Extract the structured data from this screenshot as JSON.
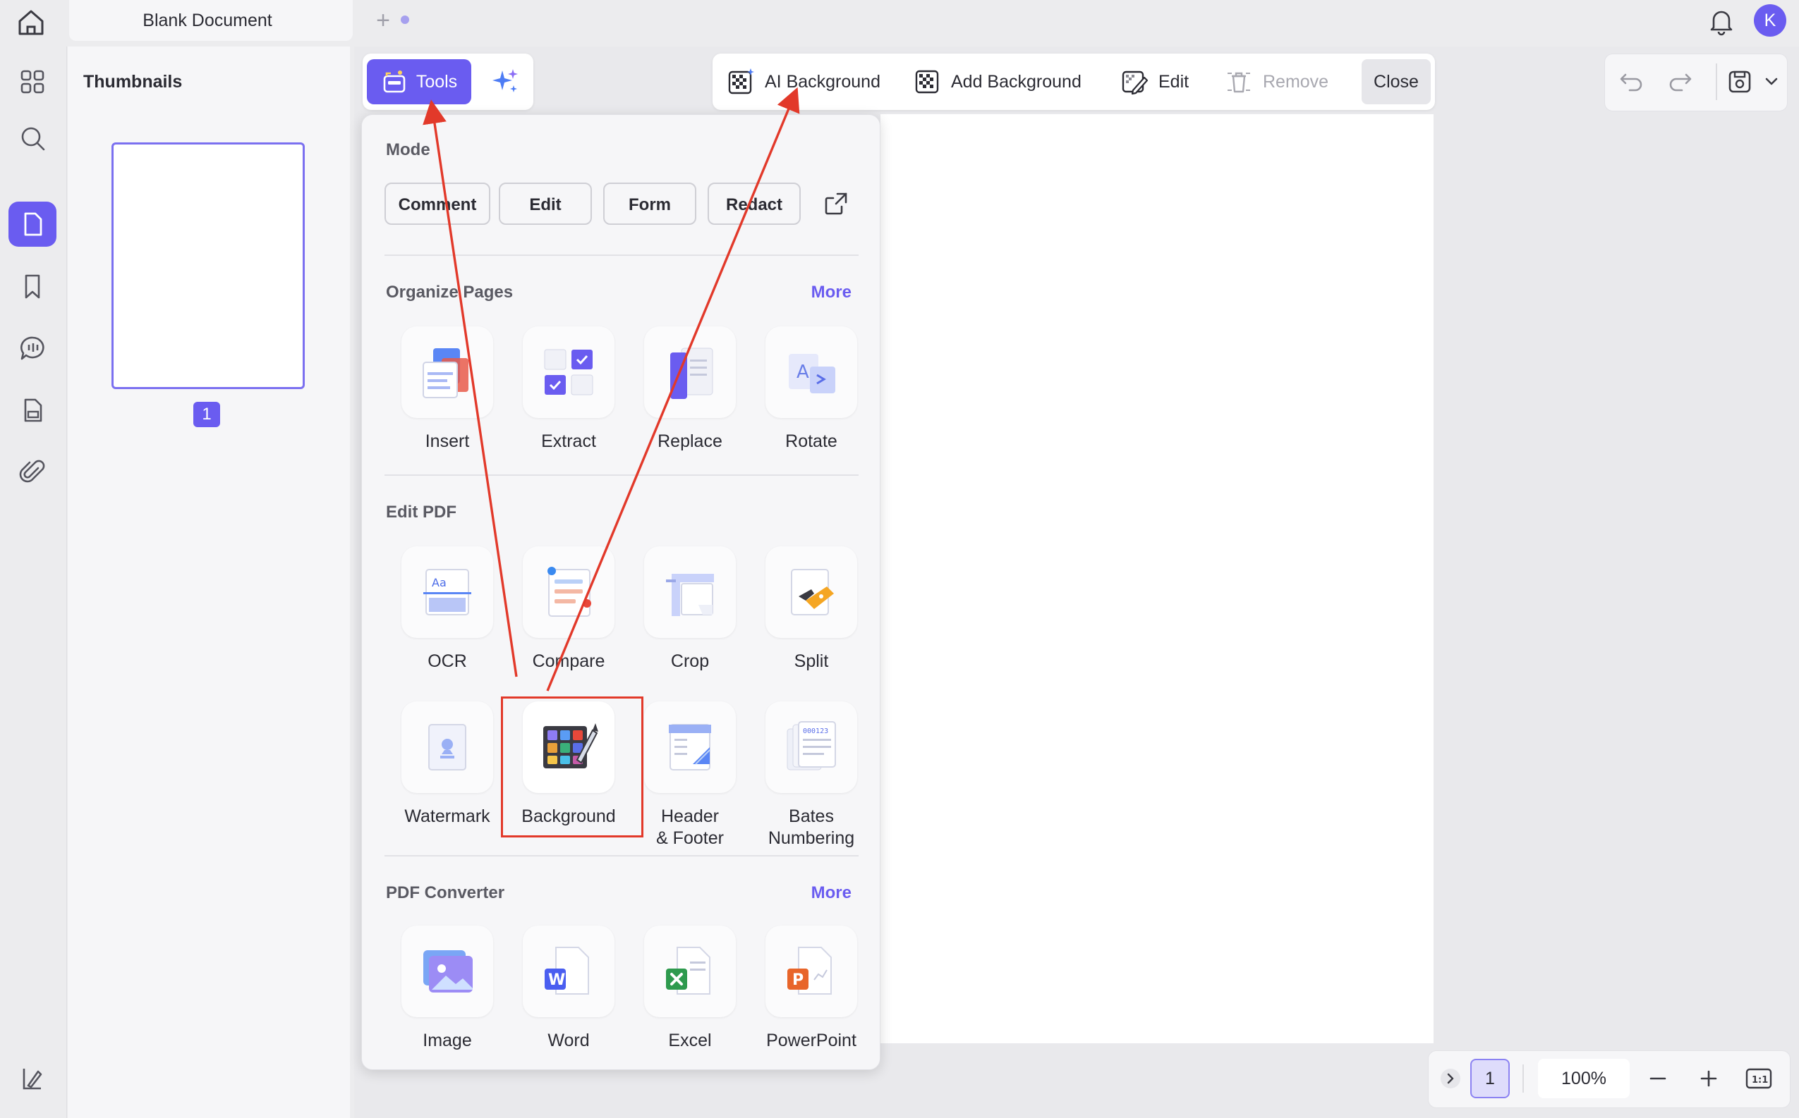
{
  "tab": {
    "title": "Blank Document"
  },
  "topbar": {
    "avatar_initial": "K"
  },
  "thumbnails": {
    "title": "Thumbnails",
    "page_number": "1"
  },
  "toolbar": {
    "tools_label": "Tools"
  },
  "background_bar": {
    "ai_background": "AI Background",
    "add_background": "Add Background",
    "edit": "Edit",
    "remove": "Remove",
    "close": "Close"
  },
  "popup": {
    "mode_title": "Mode",
    "mode_buttons": [
      "Comment",
      "Edit",
      "Form",
      "Redact"
    ],
    "organize_title": "Organize Pages",
    "organize_more": "More",
    "organize_tools": [
      "Insert",
      "Extract",
      "Replace",
      "Rotate"
    ],
    "edit_title": "Edit PDF",
    "edit_tools": [
      "OCR",
      "Compare",
      "Crop",
      "Split",
      "Watermark",
      "Background",
      "Header\n& Footer",
      "Bates\nNumbering"
    ],
    "converter_title": "PDF Converter",
    "converter_more": "More",
    "converter_tools": [
      "Image",
      "Word",
      "Excel",
      "PowerPoint"
    ]
  },
  "zoom": {
    "page": "1",
    "value": "100%"
  },
  "colors": {
    "accent": "#6a5cf0",
    "annotation": "#e2392a",
    "page": "#ffffff"
  }
}
